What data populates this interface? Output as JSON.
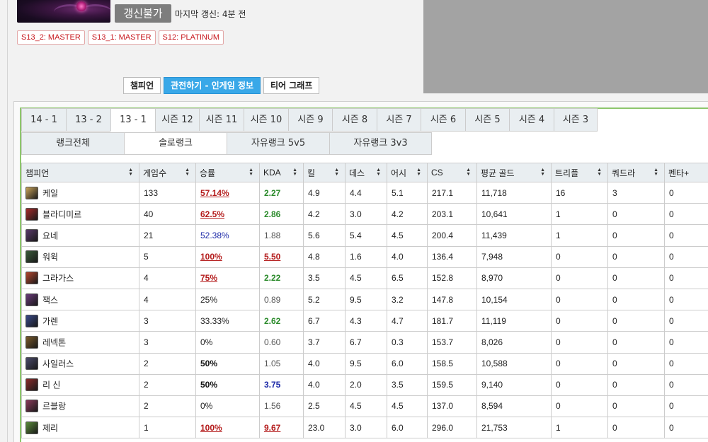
{
  "profile": {
    "refresh_label": "갱신불가",
    "last_update": "마지막 갱신: 4분 전",
    "tier_history": [
      "S13_2: MASTER",
      "S13_1: MASTER",
      "S12: PLATINUM"
    ]
  },
  "view_buttons": [
    {
      "label": "챔피언",
      "active": false
    },
    {
      "label": "관전하기 - 인게임 정보",
      "active": true
    },
    {
      "label": "티어 그래프",
      "active": false
    }
  ],
  "season_tabs": [
    {
      "label": "14 - 1",
      "active": false
    },
    {
      "label": "13 - 2",
      "active": false
    },
    {
      "label": "13 - 1",
      "active": true
    },
    {
      "label": "시즌 12",
      "active": false
    },
    {
      "label": "시즌 11",
      "active": false
    },
    {
      "label": "시즌 10",
      "active": false
    },
    {
      "label": "시즌 9",
      "active": false
    },
    {
      "label": "시즌 8",
      "active": false
    },
    {
      "label": "시즌 7",
      "active": false
    },
    {
      "label": "시즌 6",
      "active": false
    },
    {
      "label": "시즌 5",
      "active": false
    },
    {
      "label": "시즌 4",
      "active": false
    },
    {
      "label": "시즌 3",
      "active": false
    }
  ],
  "queue_tabs": [
    {
      "label": "랭크전체",
      "active": false
    },
    {
      "label": "솔로랭크",
      "active": true
    },
    {
      "label": "자유랭크 5v5",
      "active": false
    },
    {
      "label": "자유랭크 3v3",
      "active": false
    }
  ],
  "table": {
    "columns": [
      "챔피언",
      "게임수",
      "승률",
      "KDA",
      "킬",
      "데스",
      "어시",
      "CS",
      "평균 골드",
      "트리플",
      "쿼드라",
      "펜타+"
    ],
    "rows": [
      {
        "champ": "케일",
        "icon_color": "#c9a45a",
        "games": "133",
        "winrate": "57.14%",
        "wr_style": "red",
        "kda": "2.27",
        "kda_style": "green",
        "kills": "4.9",
        "deaths": "4.4",
        "assists": "5.1",
        "cs": "217.1",
        "gold": "11,718",
        "triple": "16",
        "quadra": "3",
        "penta": "0"
      },
      {
        "champ": "블라디미르",
        "icon_color": "#a82a2a",
        "games": "40",
        "winrate": "62.5%",
        "wr_style": "red",
        "kda": "2.86",
        "kda_style": "green",
        "kills": "4.2",
        "deaths": "3.0",
        "assists": "4.2",
        "cs": "203.1",
        "gold": "10,641",
        "triple": "1",
        "quadra": "0",
        "penta": "0"
      },
      {
        "champ": "요네",
        "icon_color": "#5a3a6a",
        "games": "21",
        "winrate": "52.38%",
        "wr_style": "blue",
        "kda": "1.88",
        "kda_style": "gray",
        "kills": "5.6",
        "deaths": "5.4",
        "assists": "4.5",
        "cs": "200.4",
        "gold": "11,439",
        "triple": "1",
        "quadra": "0",
        "penta": "0"
      },
      {
        "champ": "워윅",
        "icon_color": "#3a5a3a",
        "games": "5",
        "winrate": "100%",
        "wr_style": "red",
        "kda": "5.50",
        "kda_style": "red",
        "kills": "4.8",
        "deaths": "1.6",
        "assists": "4.0",
        "cs": "136.4",
        "gold": "7,948",
        "triple": "0",
        "quadra": "0",
        "penta": "0"
      },
      {
        "champ": "그라가스",
        "icon_color": "#b4462e",
        "games": "4",
        "winrate": "75%",
        "wr_style": "red",
        "kda": "2.22",
        "kda_style": "green",
        "kills": "3.5",
        "deaths": "4.5",
        "assists": "6.5",
        "cs": "152.8",
        "gold": "8,970",
        "triple": "0",
        "quadra": "0",
        "penta": "0"
      },
      {
        "champ": "잭스",
        "icon_color": "#6a3a7a",
        "games": "4",
        "winrate": "25%",
        "wr_style": "norm",
        "kda": "0.89",
        "kda_style": "gray",
        "kills": "5.2",
        "deaths": "9.5",
        "assists": "3.2",
        "cs": "147.8",
        "gold": "10,154",
        "triple": "0",
        "quadra": "0",
        "penta": "0"
      },
      {
        "champ": "가렌",
        "icon_color": "#3a4a8a",
        "games": "3",
        "winrate": "33.33%",
        "wr_style": "norm",
        "kda": "2.62",
        "kda_style": "green",
        "kills": "6.7",
        "deaths": "4.3",
        "assists": "4.7",
        "cs": "181.7",
        "gold": "11,119",
        "triple": "0",
        "quadra": "0",
        "penta": "0"
      },
      {
        "champ": "레넥톤",
        "icon_color": "#7a5a2a",
        "games": "3",
        "winrate": "0%",
        "wr_style": "norm",
        "kda": "0.60",
        "kda_style": "gray",
        "kills": "3.7",
        "deaths": "6.7",
        "assists": "0.3",
        "cs": "153.7",
        "gold": "8,026",
        "triple": "0",
        "quadra": "0",
        "penta": "0"
      },
      {
        "champ": "사일러스",
        "icon_color": "#4a4a6a",
        "games": "2",
        "winrate": "50%",
        "wr_style": "bold",
        "kda": "1.05",
        "kda_style": "gray",
        "kills": "4.0",
        "deaths": "9.5",
        "assists": "6.0",
        "cs": "158.5",
        "gold": "10,588",
        "triple": "0",
        "quadra": "0",
        "penta": "0"
      },
      {
        "champ": "리 신",
        "icon_color": "#8a2a2a",
        "games": "2",
        "winrate": "50%",
        "wr_style": "bold",
        "kda": "3.75",
        "kda_style": "blue",
        "kills": "4.0",
        "deaths": "2.0",
        "assists": "3.5",
        "cs": "159.5",
        "gold": "9,140",
        "triple": "0",
        "quadra": "0",
        "penta": "0"
      },
      {
        "champ": "르블랑",
        "icon_color": "#8a3a5a",
        "games": "2",
        "winrate": "0%",
        "wr_style": "norm",
        "kda": "1.56",
        "kda_style": "gray",
        "kills": "2.5",
        "deaths": "4.5",
        "assists": "4.5",
        "cs": "137.0",
        "gold": "8,594",
        "triple": "0",
        "quadra": "0",
        "penta": "0"
      },
      {
        "champ": "제리",
        "icon_color": "#5a8a3a",
        "games": "1",
        "winrate": "100%",
        "wr_style": "red",
        "kda": "9.67",
        "kda_style": "red",
        "kills": "23.0",
        "deaths": "3.0",
        "assists": "6.0",
        "cs": "296.0",
        "gold": "21,753",
        "triple": "1",
        "quadra": "0",
        "penta": "0"
      }
    ]
  }
}
